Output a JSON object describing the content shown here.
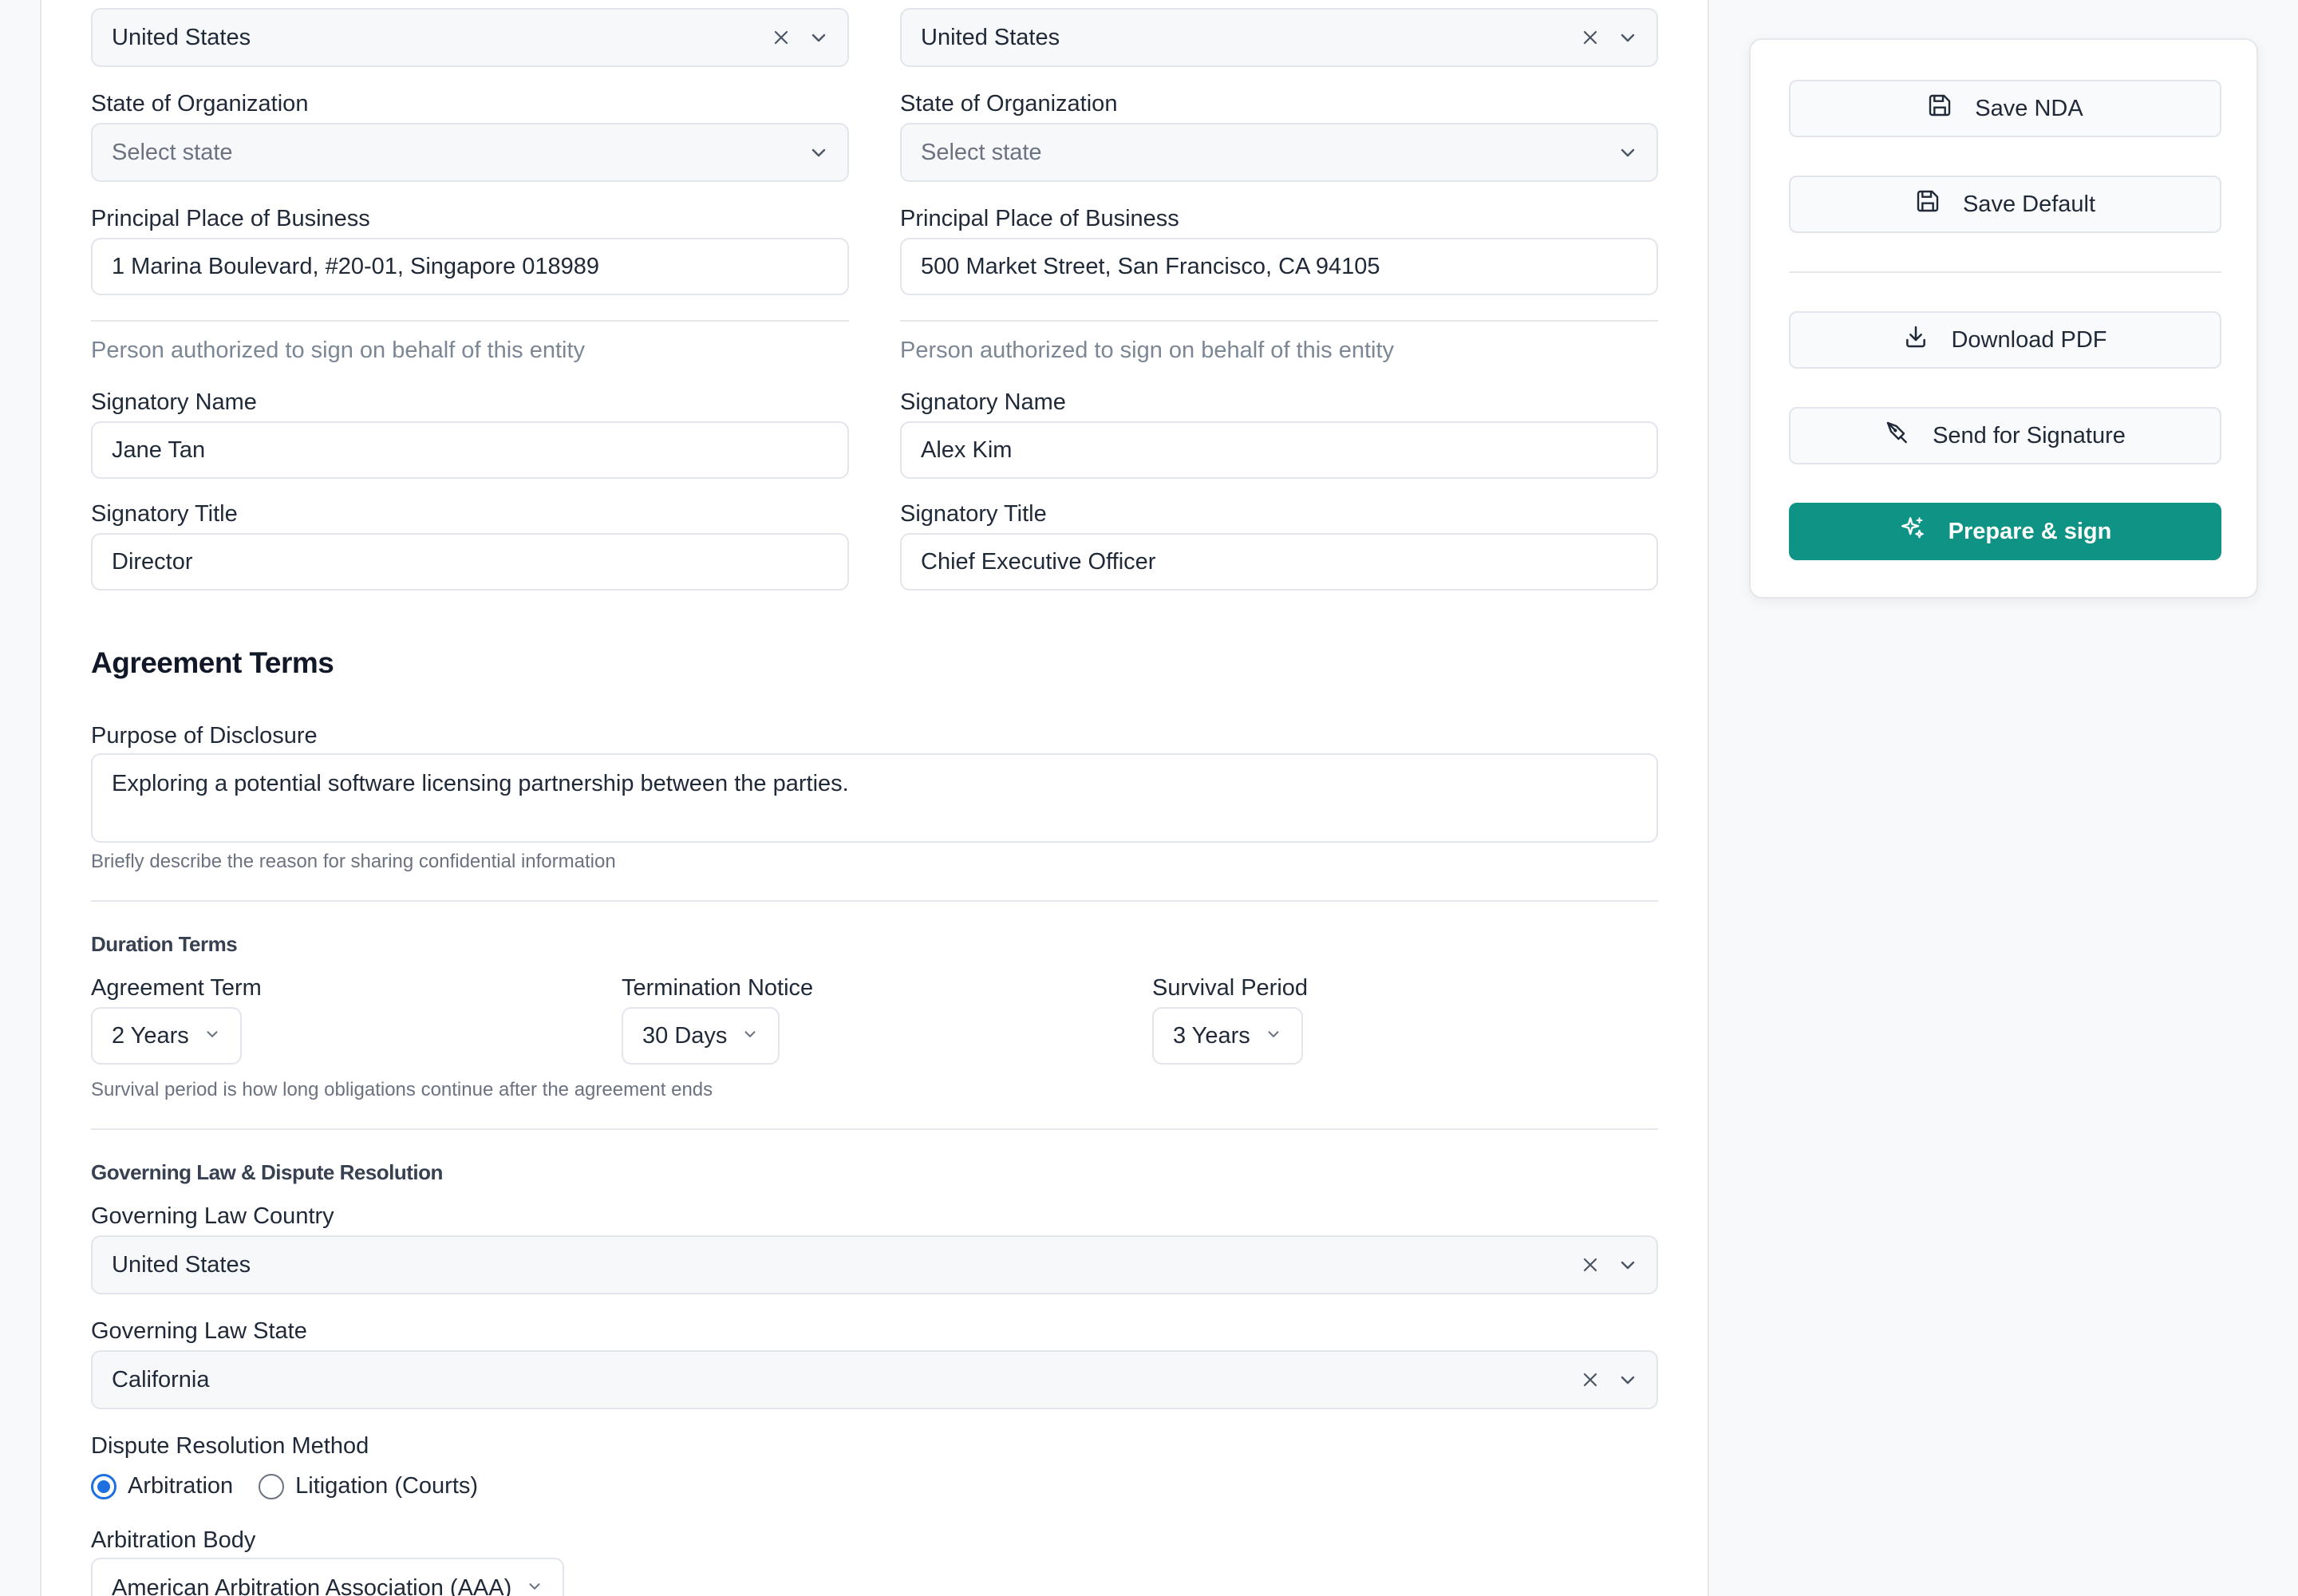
{
  "left_party": {
    "country": "United States",
    "state_label": "State of Organization",
    "state_placeholder": "Select state",
    "address_label": "Principal Place of Business",
    "address_value": "1 Marina Boulevard, #20-01, Singapore 018989",
    "signer_hint": "Person authorized to sign on behalf of this entity",
    "signatory_name_label": "Signatory Name",
    "signatory_name": "Jane Tan",
    "signatory_title_label": "Signatory Title",
    "signatory_title": "Director"
  },
  "right_party": {
    "country": "United States",
    "state_label": "State of Organization",
    "state_placeholder": "Select state",
    "address_label": "Principal Place of Business",
    "address_value": "500 Market Street, San Francisco, CA 94105",
    "signer_hint": "Person authorized to sign on behalf of this entity",
    "signatory_name_label": "Signatory Name",
    "signatory_name": "Alex Kim",
    "signatory_title_label": "Signatory Title",
    "signatory_title": "Chief Executive Officer"
  },
  "agreement": {
    "title": "Agreement Terms",
    "purpose_label": "Purpose of Disclosure",
    "purpose_value": "Exploring a potential software licensing partnership between the parties.",
    "purpose_hint": "Briefly describe the reason for sharing confidential information",
    "duration_title": "Duration Terms",
    "term_label": "Agreement Term",
    "term_value": "2 Years",
    "notice_label": "Termination Notice",
    "notice_value": "30 Days",
    "survival_label": "Survival Period",
    "survival_value": "3 Years",
    "survival_hint": "Survival period is how long obligations continue after the agreement ends",
    "law_title": "Governing Law & Dispute Resolution",
    "law_country_label": "Governing Law Country",
    "law_country_value": "United States",
    "law_state_label": "Governing Law State",
    "law_state_value": "California",
    "dispute_label": "Dispute Resolution Method",
    "dispute_options": [
      "Arbitration",
      "Litigation (Courts)"
    ],
    "dispute_selected": "Arbitration",
    "arb_body_label": "Arbitration Body",
    "arb_body_value": "American Arbitration Association (AAA)"
  },
  "actions": {
    "save_nda": "Save NDA",
    "save_default": "Save Default",
    "download_pdf": "Download PDF",
    "send_signature": "Send for Signature",
    "prepare_sign": "Prepare & sign"
  },
  "colors": {
    "primary": "#0e9384",
    "radio_selected": "#1e6fe0"
  }
}
